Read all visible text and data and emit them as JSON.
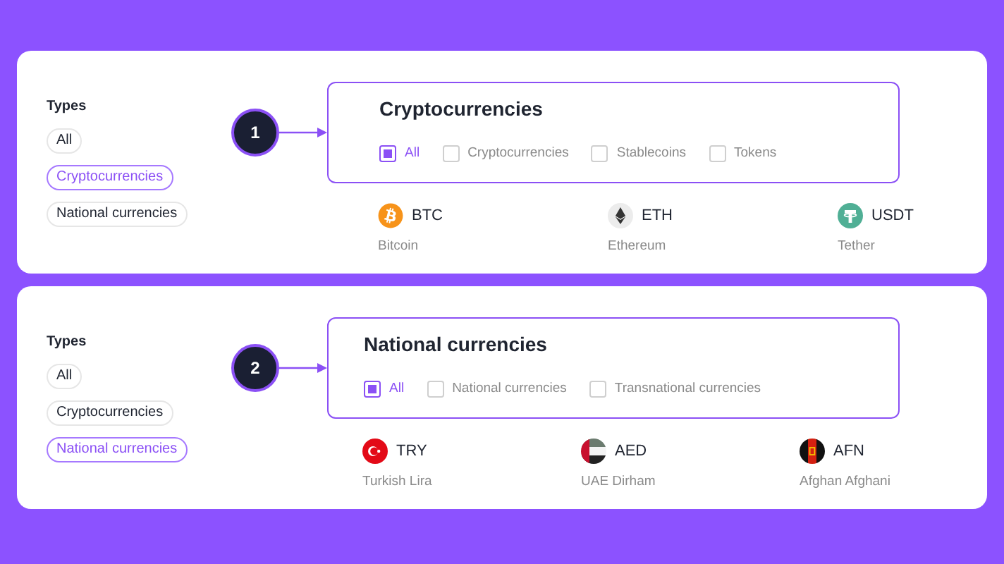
{
  "panels": [
    {
      "types_title": "Types",
      "types": [
        {
          "label": "All",
          "selected": false
        },
        {
          "label": "Cryptocurrencies",
          "selected": true
        },
        {
          "label": "National currencies",
          "selected": false
        }
      ],
      "step": "1",
      "box": {
        "title": "Cryptocurrencies",
        "filters": [
          {
            "label": "All",
            "checked": true
          },
          {
            "label": "Cryptocurrencies",
            "checked": false
          },
          {
            "label": "Stablecoins",
            "checked": false
          },
          {
            "label": "Tokens",
            "checked": false
          }
        ]
      },
      "currencies": [
        {
          "code": "BTC",
          "name": "Bitcoin"
        },
        {
          "code": "ETH",
          "name": "Ethereum"
        },
        {
          "code": "USDT",
          "name": "Tether"
        }
      ]
    },
    {
      "types_title": "Types",
      "types": [
        {
          "label": "All",
          "selected": false
        },
        {
          "label": "Cryptocurrencies",
          "selected": false
        },
        {
          "label": "National currencies",
          "selected": true
        }
      ],
      "step": "2",
      "box": {
        "title": "National currencies",
        "filters": [
          {
            "label": "All",
            "checked": true
          },
          {
            "label": "National currencies",
            "checked": false
          },
          {
            "label": "Transnational currencies",
            "checked": false
          }
        ]
      },
      "currencies": [
        {
          "code": "TRY",
          "name": "Turkish Lira"
        },
        {
          "code": "AED",
          "name": "UAE Dirham"
        },
        {
          "code": "AFN",
          "name": "Afghan Afghani"
        }
      ]
    }
  ]
}
